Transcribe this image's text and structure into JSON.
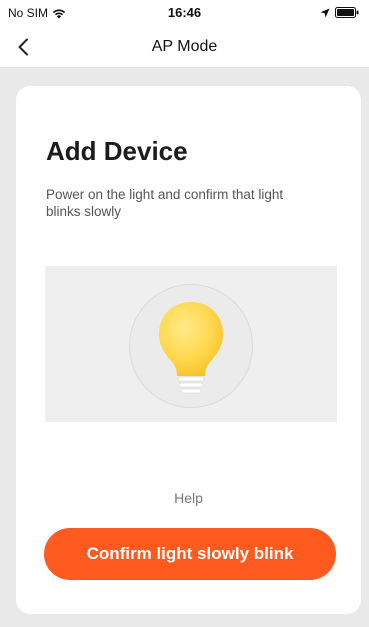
{
  "status_bar": {
    "carrier": "No SIM",
    "time": "16:46",
    "icons": [
      "wifi-icon",
      "location-arrow-icon",
      "battery-icon"
    ]
  },
  "nav": {
    "title": "AP Mode",
    "back_icon": "chevron-left-icon"
  },
  "card": {
    "title": "Add Device",
    "description": "Power on the light and confirm that light blinks slowly",
    "illustration_icon": "light-bulb-icon",
    "help_label": "Help",
    "confirm_label": "Confirm light slowly blink"
  },
  "colors": {
    "accent": "#ff5a1f",
    "bulb": "#ffd84d",
    "background": "#e9e9e9",
    "card": "#ffffff"
  }
}
